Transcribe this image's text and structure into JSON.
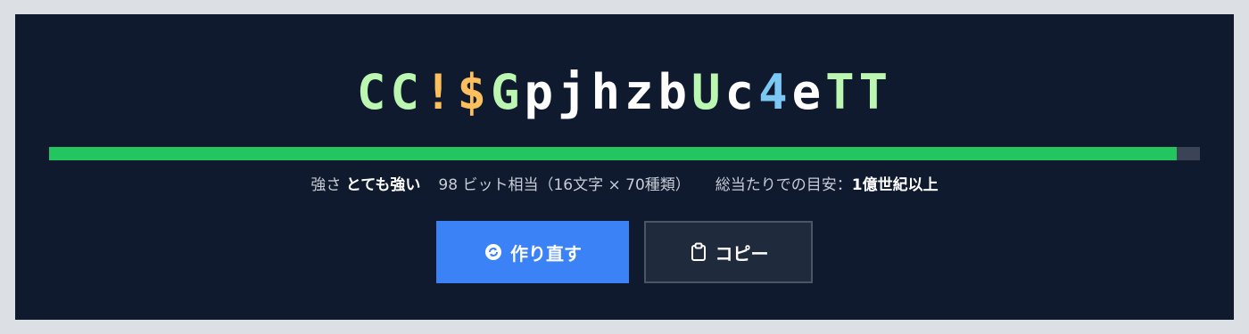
{
  "password": {
    "chars": [
      {
        "c": "C",
        "color": "#bbf7b0"
      },
      {
        "c": "C",
        "color": "#bbf7b0"
      },
      {
        "c": "!",
        "color": "#fbbf5d"
      },
      {
        "c": "$",
        "color": "#fbbf5d"
      },
      {
        "c": "G",
        "color": "#bbf7b0"
      },
      {
        "c": "p",
        "color": "#ffffff"
      },
      {
        "c": "j",
        "color": "#ffffff"
      },
      {
        "c": "h",
        "color": "#ffffff"
      },
      {
        "c": "z",
        "color": "#ffffff"
      },
      {
        "c": "b",
        "color": "#ffffff"
      },
      {
        "c": "U",
        "color": "#bbf7b0"
      },
      {
        "c": "c",
        "color": "#ffffff"
      },
      {
        "c": "4",
        "color": "#7cc8f5"
      },
      {
        "c": "e",
        "color": "#ffffff"
      },
      {
        "c": "T",
        "color": "#bbf7b0"
      },
      {
        "c": "T",
        "color": "#bbf7b0"
      }
    ]
  },
  "strength": {
    "fill_percent": 98,
    "fill_color": "#22c55e",
    "track_color": "#3a4456",
    "label": "強さ",
    "value": "とても強い",
    "bits_text": "98 ビット相当（16文字 × 70種類）",
    "crack_label": "総当たりでの目安：",
    "crack_value": "1億世紀以上"
  },
  "buttons": {
    "regenerate_label": "作り直す",
    "regenerate_icon": "refresh-icon",
    "regenerate_color": "#3b82f6",
    "copy_label": "コピー",
    "copy_icon": "clipboard-icon"
  }
}
